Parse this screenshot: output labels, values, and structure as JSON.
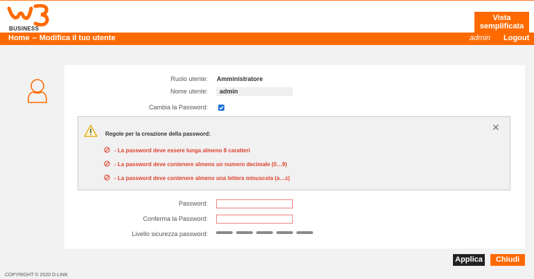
{
  "header": {
    "logo_text": "BUSINESS",
    "simple_view_button": "Vista semplificata"
  },
  "navbar": {
    "breadcrumb_home": "Home",
    "breadcrumb_separator": "–",
    "breadcrumb_current": "Modifica il tuo utente",
    "username": "admin",
    "logout": "Logout"
  },
  "form": {
    "role_label": "Ruolo utente:",
    "role_value": "Amministratore",
    "name_label": "Nome utente:",
    "name_value": "admin",
    "change_password_label": "Cambia la Password:",
    "change_password_checked": true,
    "password_label": "Password:",
    "password_value": "",
    "confirm_label": "Conferma la Password:",
    "confirm_value": "",
    "strength_label": "Livello sicurezza password:",
    "strength_level": 0
  },
  "rules": {
    "title": "Regole per la creazione della password:",
    "items": [
      "- La password deve essere lunga almeno 8 caratteri",
      "- La password deve contenere almeno un numero decimale (0…9)",
      "- La password deve contenere almeno una lettera minuscola (a…z)"
    ],
    "close_symbol": "✕"
  },
  "buttons": {
    "apply": "Applica",
    "close": "Chiudi"
  },
  "footer": {
    "copyright": "COPYRIGHT © 2020 D-LINK"
  },
  "colors": {
    "brand_orange": "#ff6a00",
    "error_red": "#e0412f",
    "checkbox_blue": "#1e6fd9"
  }
}
